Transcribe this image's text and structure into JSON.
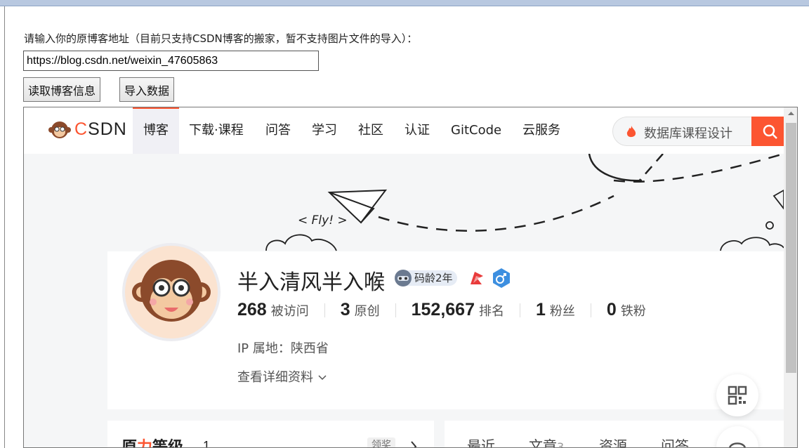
{
  "form": {
    "label": "请输入你的原博客地址（目前只支持CSDN博客的搬家，暂不支持图片文件的导入）：",
    "url_value": "https://blog.csdn.net/weixin_47605863",
    "read_button": "读取博客信息",
    "import_button": "导入数据"
  },
  "csdn": {
    "logo_c": "C",
    "logo_rest": "SDN",
    "nav": [
      "博客",
      "下载·课程",
      "问答",
      "学习",
      "社区",
      "认证",
      "GitCode",
      "云服务"
    ],
    "active_nav": "博客",
    "search_placeholder": "数据库课程设计",
    "hero_text": "< Fly! >",
    "profile": {
      "name": "半入清风半入喉",
      "badge": "码龄2年",
      "stats": [
        {
          "value": "268",
          "label": "被访问"
        },
        {
          "value": "3",
          "label": "原创"
        },
        {
          "value": "152,667",
          "label": "排名"
        },
        {
          "value": "1",
          "label": "粉丝"
        },
        {
          "value": "0",
          "label": "铁粉"
        }
      ],
      "ip": "IP 属地：陕西省",
      "more": "查看详细资料"
    },
    "level": {
      "title_a": "原",
      "title_b": "力",
      "title_c": "等级",
      "num": "1",
      "reward": "领奖"
    },
    "tabs": [
      {
        "label": "最近",
        "count": ""
      },
      {
        "label": "文章",
        "count": "3"
      },
      {
        "label": "资源",
        "count": ""
      },
      {
        "label": "问答",
        "count": ""
      }
    ],
    "accent": "#fc5531"
  }
}
